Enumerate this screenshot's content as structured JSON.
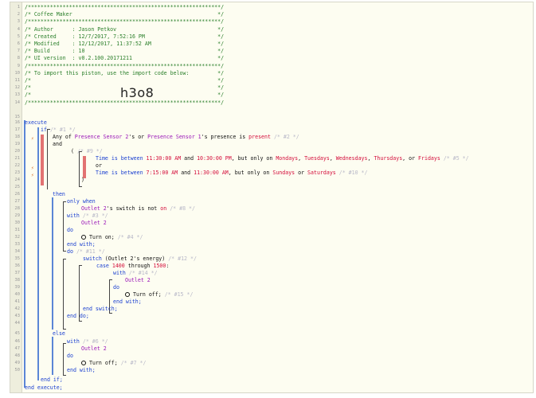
{
  "header_lines": [
    "/*************************************************************/",
    "/* Coffee Maker                                              */",
    "/*************************************************************/",
    "/* Author      : Jason Petkov                                */",
    "/* Created     : 12/7/2017, 7:52:16 PM                       */",
    "/* Modified    : 12/12/2017, 11:37:52 AM                     */",
    "/* Build       : 10                                          */",
    "/* UI version  : v0.2.100.20171211                           */",
    "/*************************************************************/",
    "/* To import this piston, use the import code below:         */",
    "/*                                                           */",
    "/*                                                           */",
    "/*                                                           */",
    "/*************************************************************/"
  ],
  "import_code": "h3o8",
  "line_numbers": [
    "1",
    "2",
    "3",
    "4",
    "5",
    "6",
    "7",
    "8",
    "9",
    "10",
    "11",
    "12",
    "13",
    "14",
    "15",
    "16",
    "17",
    "18",
    "19",
    "20",
    "21",
    "22",
    "23",
    "24",
    "25",
    "26",
    "27",
    "28",
    "29",
    "30",
    "31",
    "32",
    "33",
    "34",
    "35",
    "36",
    "37",
    "38",
    "39",
    "40",
    "41",
    "42",
    "43",
    "44",
    "45",
    "46",
    "47",
    "48",
    "49",
    "50"
  ],
  "code": {
    "execute": "execute",
    "if": "if",
    "if_cmt": "/* #1 */",
    "any_of": "Any of ",
    "sensor2": "Presence Sensor 2",
    "s_or": "'s or ",
    "sensor1": "Presence Sensor 1",
    "s_presence": "'s presence is ",
    "present": "present",
    "cond2_cmt": "/* #2 */",
    "and": "and",
    "paren_open": "(",
    "group_cmt": "/* #9 */",
    "time_is_between": "Time is between ",
    "t1a": "11:30:00 AM",
    "t_and": " and ",
    "t1b": "10:30:00 PM",
    "but_only_on": ", but only on ",
    "mon": "Mondays",
    "tue": "Tuesdays",
    "wed": "Wednesdays",
    "thu": "Thursdays",
    "fri": "Fridays",
    "comma": ", ",
    "or_word": ", or ",
    "cmt5": "/* #5 */",
    "or": "or",
    "t2a": "7:15:00 AM",
    "t2b": "11:30:00 AM",
    "sun": "Sundays",
    "or_sp": " or ",
    "sat": "Saturdays",
    "cmt10": "/* #10 */",
    "paren_close": ")",
    "then": "then",
    "only_when": "only when",
    "outlet2": "Outlet 2",
    "switch_is_not": "'s switch is not ",
    "on": "on",
    "cmt8": "/* #8 */",
    "with": "with",
    "cmt3": "/* #3 */",
    "do": "do",
    "turn_on": "Turn on;",
    "cmt4": "/* #4 */",
    "end_with": "end with;",
    "cmt11": "/* #11 */",
    "switch_kw": "switch",
    "switch_expr": " (Outlet 2's energy) ",
    "cmt12": "/* #12 */",
    "case": "case ",
    "v1400": "1400",
    "through": " through ",
    "v1500": "1500",
    "colon": ":",
    "cmt14": "/* #14 */",
    "turn_off": "Turn off;",
    "cmt15": "/* #15 */",
    "end_switch": "end switch;",
    "end_do": "end do;",
    "else": "else",
    "cmt6": "/* #6 */",
    "cmt7": "/* #7 */",
    "end_if": "end if;",
    "end_execute": "end execute;"
  }
}
